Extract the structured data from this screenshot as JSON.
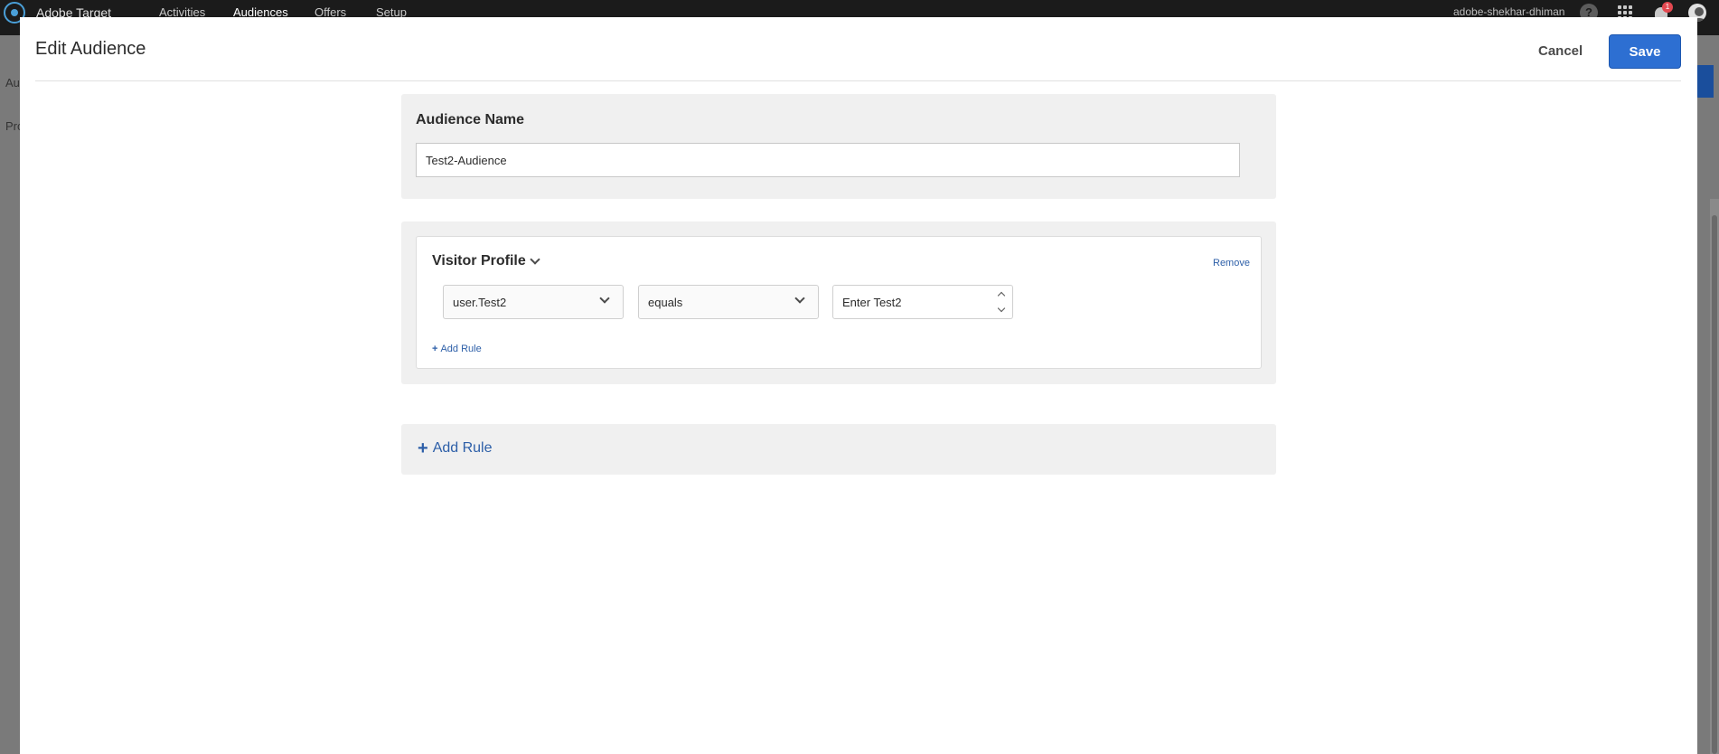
{
  "topbar": {
    "brand": "Adobe Target",
    "nav": [
      "Activities",
      "Audiences",
      "Offers",
      "Setup"
    ],
    "active_nav": "Audiences",
    "user": "adobe-shekhar-dhiman",
    "help_glyph": "?",
    "notification_count": "1",
    "icons": [
      "target-logo-icon",
      "help-icon",
      "apps-grid-icon",
      "bell-icon",
      "avatar-icon"
    ]
  },
  "background": {
    "left_text_1": "Au",
    "left_text_2": "Pro"
  },
  "modal": {
    "title": "Edit Audience",
    "cancel_label": "Cancel",
    "save_label": "Save"
  },
  "audience_name": {
    "label": "Audience Name",
    "value": "Test2-Audience"
  },
  "rule": {
    "type_label": "Visitor Profile",
    "remove_label": "Remove",
    "attribute": "user.Test2",
    "operator": "equals",
    "value_placeholder": "Enter Test2",
    "add_rule_label": "Add Rule"
  },
  "outer_add_rule_label": "Add Rule",
  "colors": {
    "primary": "#2d6fd2",
    "link": "#2d5fa8",
    "topbar": "#1b1b1b",
    "panel": "#f0f0f0"
  }
}
